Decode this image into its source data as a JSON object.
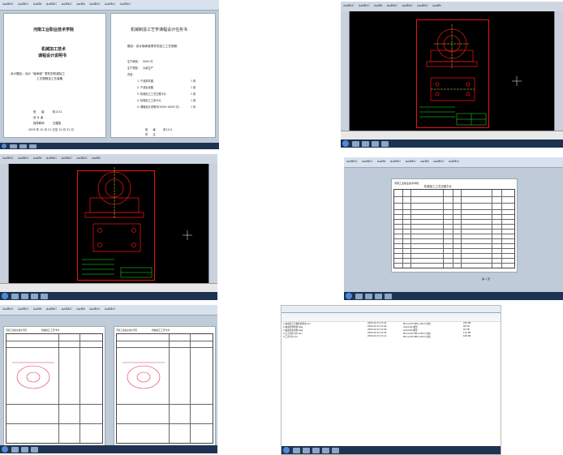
{
  "colors": {
    "cad_bg": "#000000",
    "cad_red": "#e01111",
    "cad_green": "#22ee22",
    "cad_yellow": "#f0e020",
    "taskbar": "#1e3350",
    "ribbon": "#d8e2ee"
  },
  "icons": [
    "start-orb-icon",
    "taskbar-app-icon",
    "crosshair-icon"
  ],
  "doc1": {
    "school": "河南工业职业技术学院",
    "course_line1": "机械加工技术",
    "course_line2": "课程设计说明书",
    "topic_label": "设计题目：设计 “轴承座” 零件的机械加工",
    "topic_line2": "工艺规程及工艺装备",
    "sig1": "班　　级　　　机1111",
    "sig2": "设 计 者",
    "sig3": "指导教师　　　王建国",
    "date": "2009 年 10 月 21 日至 10 月 31 日",
    "right_title": "机械制造工艺学课程设计任务书",
    "right_topic": "题目：设计轴承座零件的加工工艺规程.",
    "right_l1": "生产纲领：　5000 件",
    "right_l2": "生产类型：　大量生产",
    "right_l3": "内容：",
    "right_items": [
      "1. 产品零件图",
      "2. 产品毛坯图",
      "3. 机械加工工艺过程卡片",
      "4. 机械加工工序卡片",
      "5. 课程设计说明书(5000~8000 字)"
    ],
    "right_pages": [
      "1 张",
      "1 张",
      "1 张",
      "1 张",
      "1 份"
    ],
    "right_sig1": "班　　级　　　机1111",
    "right_sig2": "学　　生"
  },
  "doc4": {
    "header": "河南工业职业技术学院",
    "title": "机械加工工艺过程卡片",
    "page_label": "第 1 页"
  },
  "doc5": {
    "header": "河南工业职业技术学院",
    "title": "机械加工工序卡片"
  },
  "sheet": {
    "rows": [
      [
        "1.轴承座工艺规程说明书.doc",
        "2009-10-31 15:22",
        "Microsoft Office Word 文档",
        "236 KB"
      ],
      [
        "2.轴承座零件图.dwg",
        "2009-10-31 14:40",
        "AutoCAD 图形",
        "68 KB"
      ],
      [
        "3.轴承座毛坯图.dwg",
        "2009-10-31 14:58",
        "AutoCAD 图形",
        "54 KB"
      ],
      [
        "4.工艺过程卡片.doc",
        "2009-10-31 15:05",
        "Microsoft Office Word 文档",
        "112 KB"
      ],
      [
        "5.工序卡片.doc",
        "2009-10-31 15:12",
        "Microsoft Office Word 文档",
        "168 KB"
      ]
    ]
  }
}
